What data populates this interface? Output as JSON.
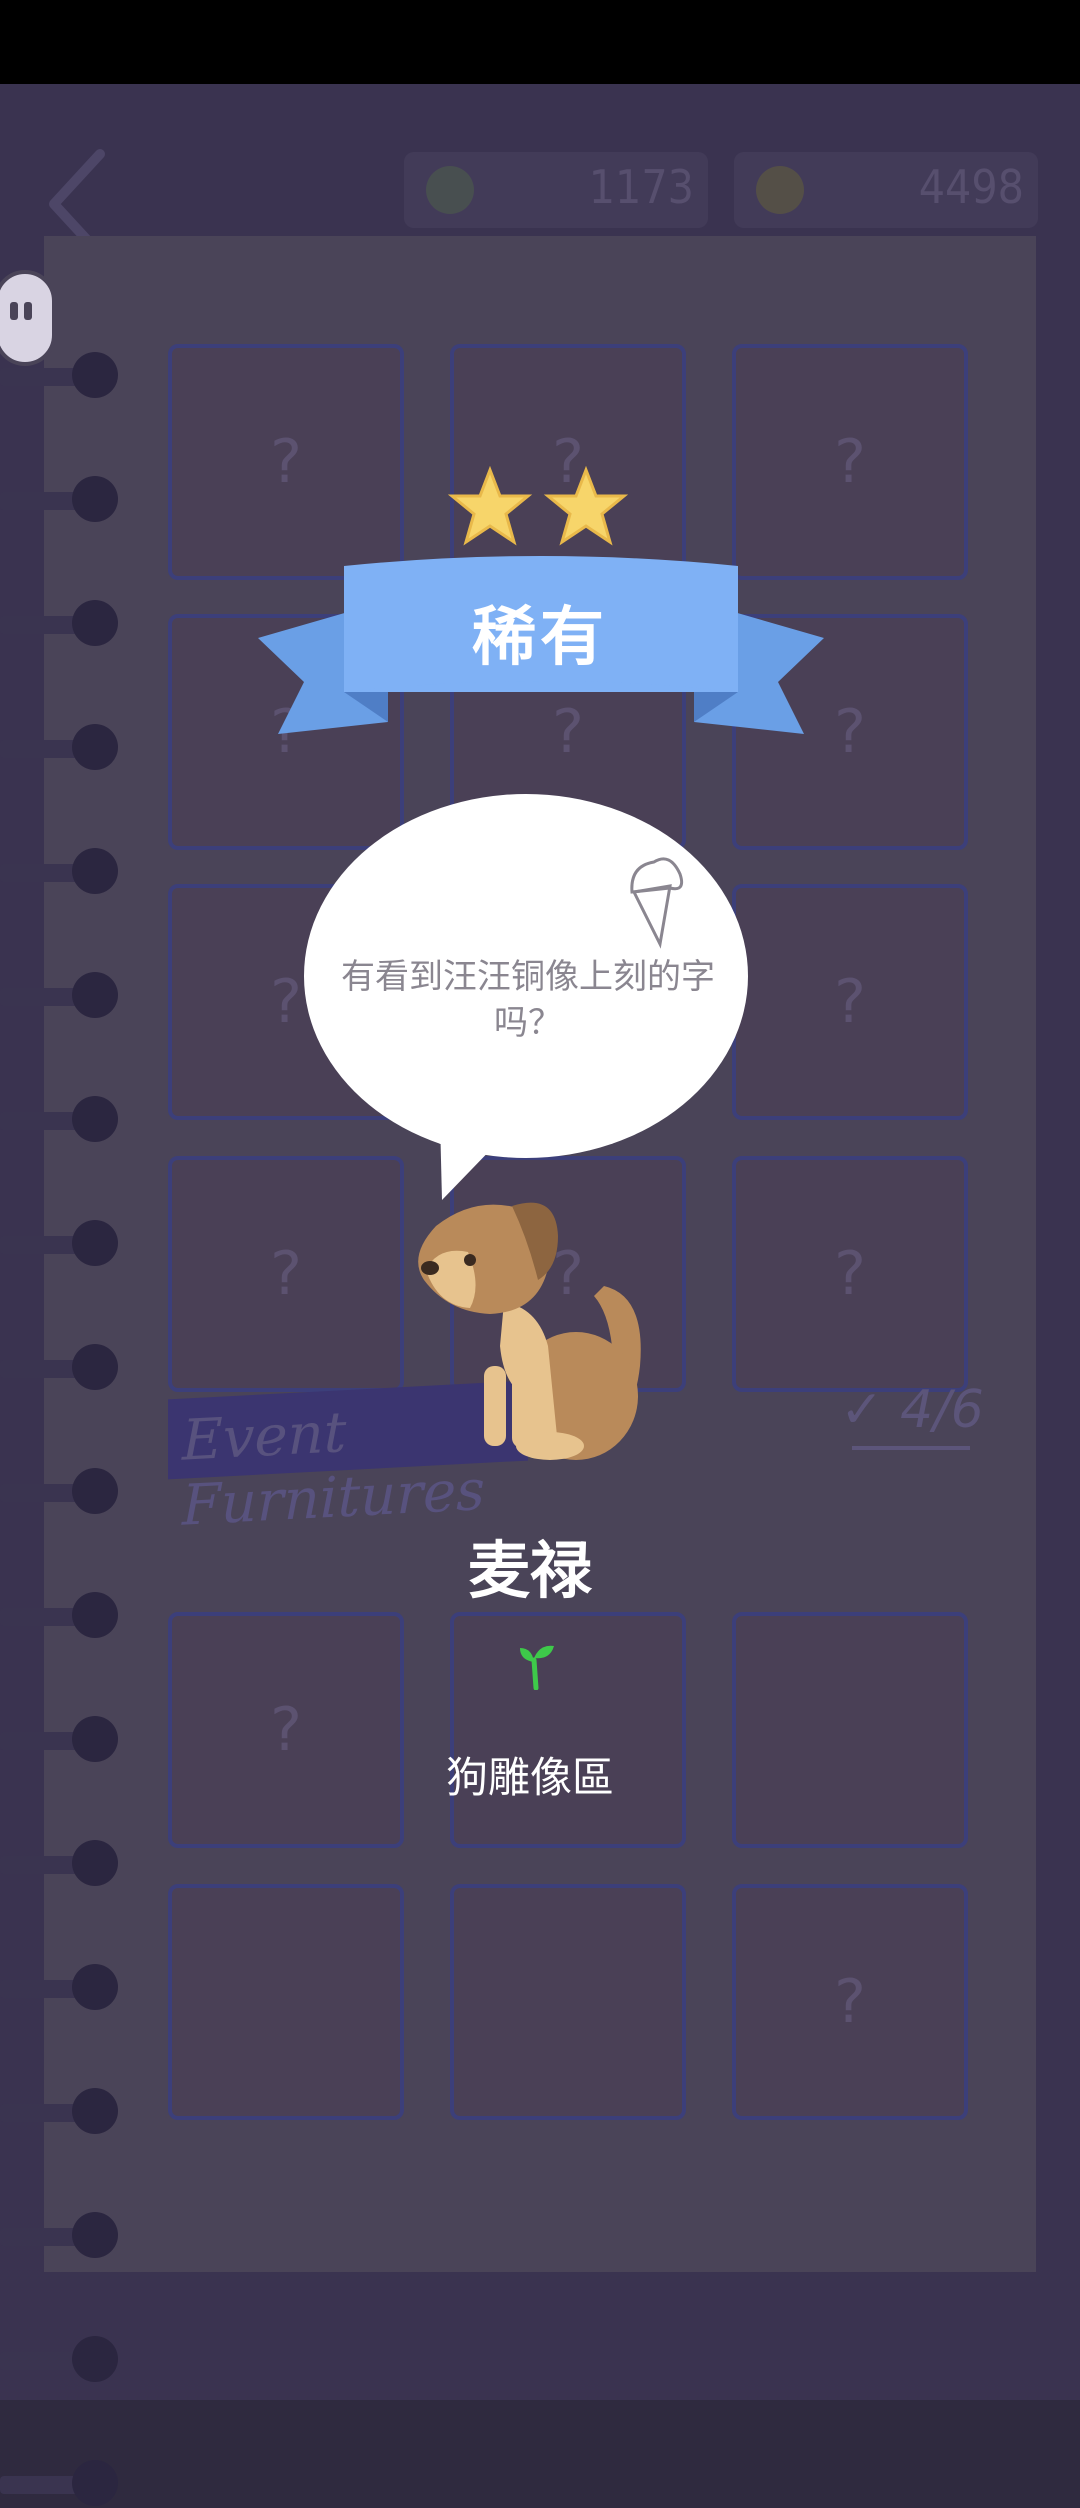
{
  "header": {
    "back_icon": "back-arrow-icon",
    "currency1": {
      "icon": "clover-icon",
      "value": "1173"
    },
    "currency2": {
      "icon": "coin-icon",
      "value": "4498"
    }
  },
  "section": {
    "title": "Event Furnitures",
    "progress": "4/6"
  },
  "popup": {
    "rarity_label": "稀有",
    "stars": 2,
    "quote": "有看到汪汪铜像上刻的字吗？",
    "character_name": "麦禄",
    "location": "狗雕像區",
    "colors": {
      "ribbon": "#7fb1f5",
      "star": "#f7d56a"
    }
  }
}
